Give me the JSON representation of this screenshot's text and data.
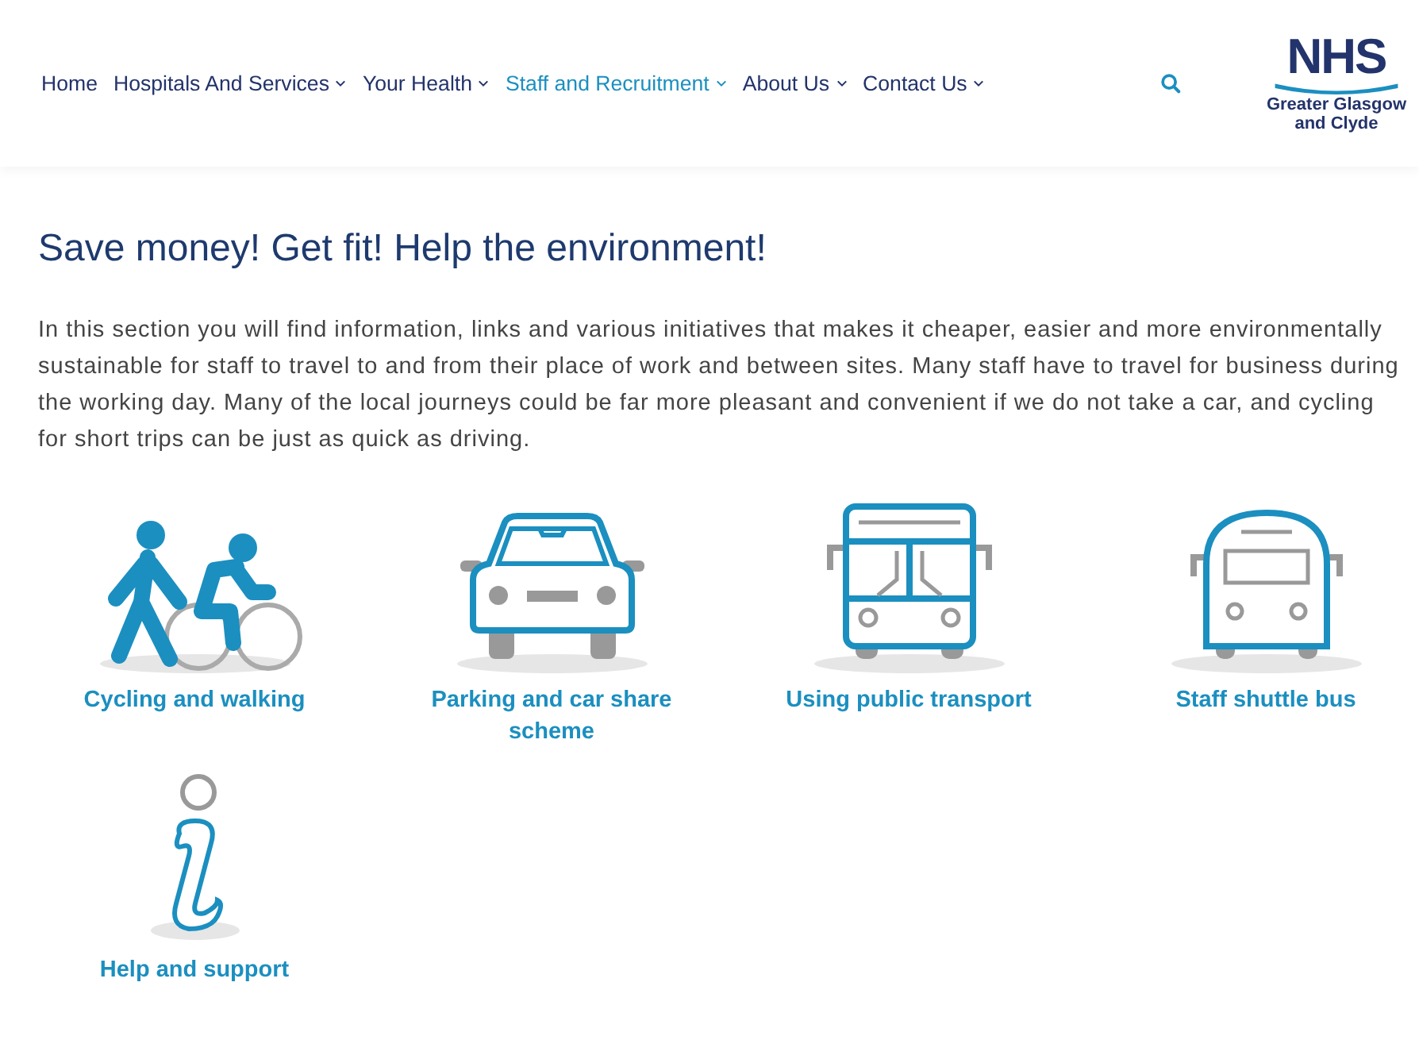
{
  "nav": {
    "items": [
      {
        "label": "Home",
        "has_dropdown": false,
        "selected": false
      },
      {
        "label": "Hospitals And Services",
        "has_dropdown": true,
        "selected": false
      },
      {
        "label": "Your Health",
        "has_dropdown": true,
        "selected": false
      },
      {
        "label": "Staff and Recruitment",
        "has_dropdown": true,
        "selected": true
      },
      {
        "label": "About Us",
        "has_dropdown": true,
        "selected": false
      },
      {
        "label": "Contact Us",
        "has_dropdown": true,
        "selected": false
      }
    ]
  },
  "logo": {
    "mark": "NHS",
    "lines": [
      "Greater Glasgow",
      "and Clyde"
    ]
  },
  "heading": "Save money! Get fit! Help the environment!",
  "intro": "In this section you will find information, links and various initiatives that makes it cheaper, easier and more environmentally sustainable for staff to travel to and from their place of work and between sites. Many staff have to travel for business during the working day. Many of the local journeys could be far more pleasant and convenient if we do not take a car, and cycling for short trips can be just as quick as driving.",
  "tiles": [
    {
      "kind": "cycling",
      "label": "Cycling and walking"
    },
    {
      "kind": "car",
      "label": "Parking and car share scheme"
    },
    {
      "kind": "bus",
      "label": "Using public transport"
    },
    {
      "kind": "shuttle",
      "label": "Staff shuttle bus"
    },
    {
      "kind": "info",
      "label": "Help and support"
    }
  ]
}
